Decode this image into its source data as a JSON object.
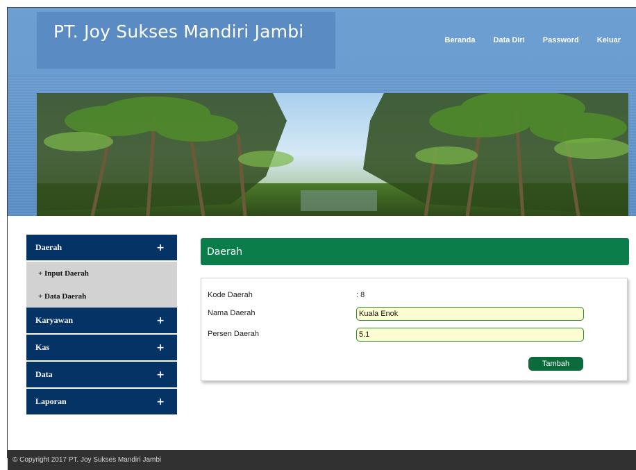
{
  "header": {
    "title": "PT. Joy Sukses Mandiri Jambi",
    "nav": [
      "Beranda",
      "Data Diri",
      "Password",
      "Keluar"
    ]
  },
  "sidebar": {
    "sections": [
      {
        "label": "Daerah",
        "icon": "+"
      },
      {
        "label": "Karyawan",
        "icon": "+"
      },
      {
        "label": "Kas",
        "icon": "+"
      },
      {
        "label": "Data",
        "icon": "+"
      },
      {
        "label": "Laporan",
        "icon": "+"
      }
    ],
    "daerah_items": [
      "+ Input Daerah",
      "+ Data Daerah"
    ]
  },
  "main": {
    "title": "Daerah",
    "form": {
      "kode_label": "Kode Daerah",
      "kode_value": ": 8",
      "nama_label": "Nama Daerah",
      "nama_value": "Kuala Enok",
      "persen_label": "Persen Daerah",
      "persen_value": "5.1",
      "submit_label": "Tambah"
    }
  },
  "footer": {
    "text": "© Copyright 2017 PT. Joy Sukses Mandiri Jambi"
  },
  "colors": {
    "header_blue": "#6b9dd1",
    "sidebar_navy": "#063366",
    "panel_green": "#0b7d4a",
    "field_bg": "#fdfdd3",
    "footer_dark": "#313131"
  }
}
